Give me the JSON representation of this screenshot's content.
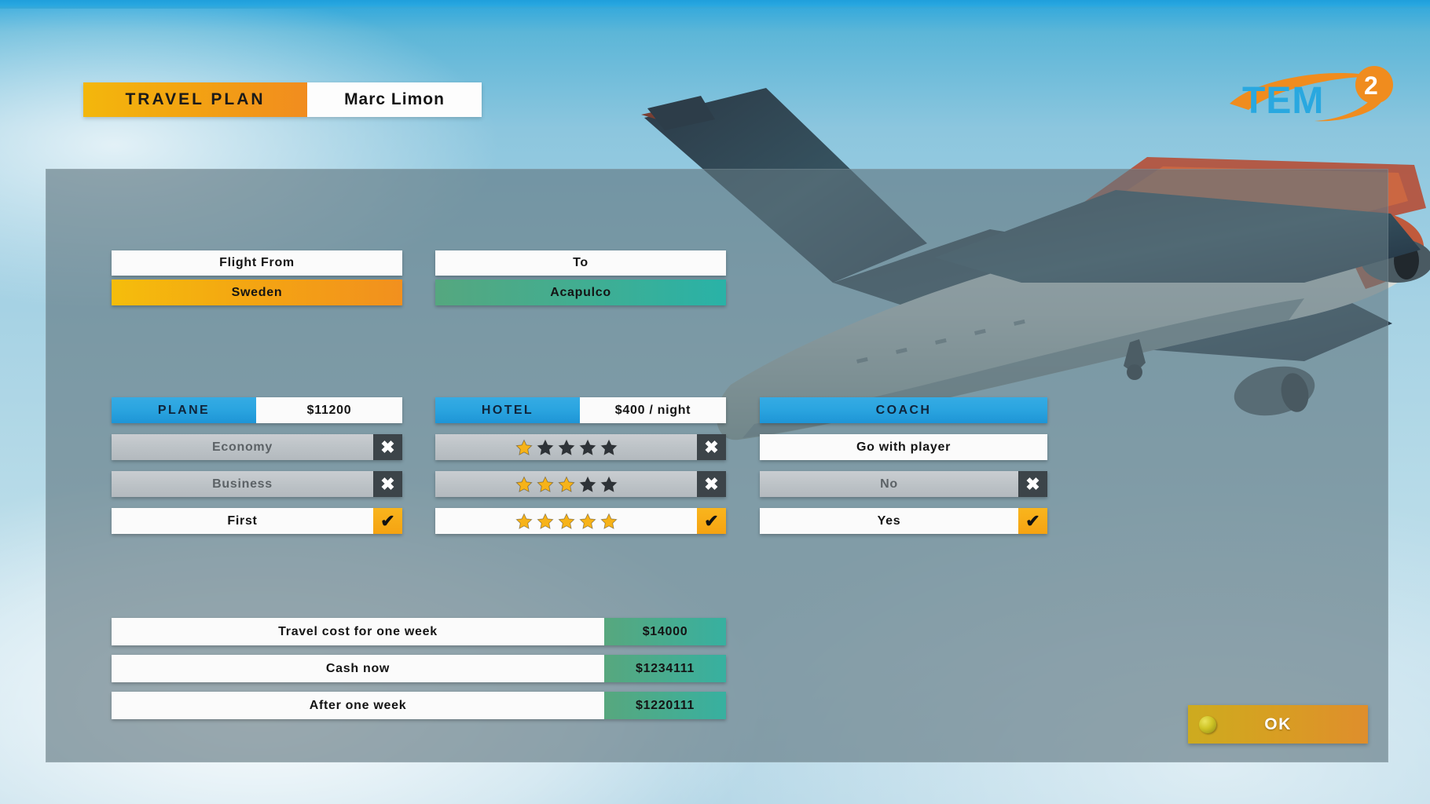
{
  "header": {
    "title": "TRAVEL PLAN",
    "player_name": "Marc Limon",
    "logo_text": "TEM",
    "logo_exponent": "2"
  },
  "flight": {
    "from_label": "Flight From",
    "from_value": "Sweden",
    "to_label": "To",
    "to_value": "Acapulco"
  },
  "plane": {
    "section_label": "PLANE",
    "price": "$11200",
    "options": [
      {
        "label": "Economy",
        "state": "unselected",
        "mark": "✖"
      },
      {
        "label": "Business",
        "state": "unselected",
        "mark": "✖"
      },
      {
        "label": "First",
        "state": "selected",
        "mark": "✔"
      }
    ]
  },
  "hotel": {
    "section_label": "HOTEL",
    "price": "$400 / night",
    "options": [
      {
        "stars_filled": 1,
        "stars_total": 5,
        "state": "unselected",
        "mark": "✖"
      },
      {
        "stars_filled": 3,
        "stars_total": 5,
        "state": "unselected",
        "mark": "✖"
      },
      {
        "stars_filled": 5,
        "stars_total": 5,
        "state": "selected",
        "mark": "✔"
      }
    ]
  },
  "coach": {
    "section_label": "COACH",
    "question": "Go with player",
    "options": [
      {
        "label": "No",
        "state": "unselected",
        "mark": "✖"
      },
      {
        "label": "Yes",
        "state": "selected",
        "mark": "✔"
      }
    ]
  },
  "summary": [
    {
      "label": "Travel cost for one week",
      "value": "$14000"
    },
    {
      "label": "Cash now",
      "value": "$1234111"
    },
    {
      "label": "After one week",
      "value": "$1220111"
    }
  ],
  "footer": {
    "ok_label": "OK"
  },
  "colors": {
    "accent_orange": "#f2901e",
    "accent_gold": "#f5bd0c",
    "accent_blue": "#2ba5e0",
    "accent_green": "#37b0a0",
    "star_gold": "#f7b319",
    "star_dark": "#2e3338",
    "panel": "#607780"
  }
}
